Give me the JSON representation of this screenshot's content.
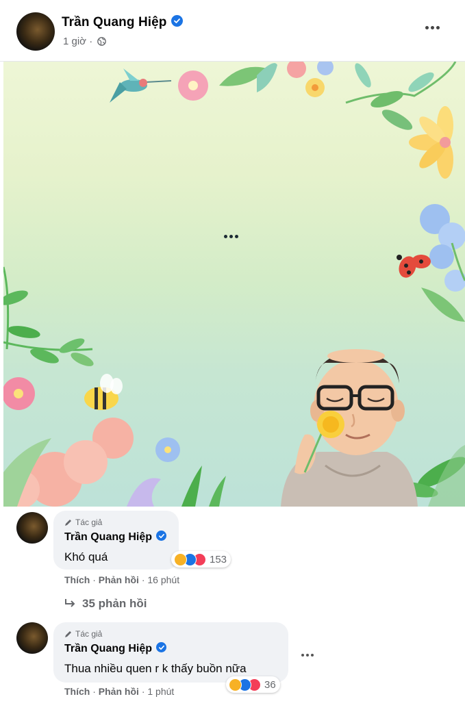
{
  "post": {
    "author": "Trần Quang Hiệp",
    "time": "1 giờ",
    "separator": "·"
  },
  "comments": [
    {
      "author_tag": "Tác giả",
      "author": "Trần Quang Hiệp",
      "text": "Khó quá",
      "reaction_count": "153",
      "like_label": "Thích",
      "reply_label": "Phản hồi",
      "time": "16 phút"
    },
    {
      "author_tag": "Tác giả",
      "author": "Trần Quang Hiệp",
      "text": "Thua nhiều quen r k thấy buồn nữa",
      "reaction_count": "36",
      "like_label": "Thích",
      "reply_label": "Phản hồi",
      "time": "1 phút"
    }
  ],
  "replies_link": "35 phản hồi",
  "icons": {
    "verified": "verified-badge-icon",
    "globe": "globe-icon",
    "more": "more-options-icon",
    "pen": "pencil-icon",
    "reply": "reply-arrow-icon",
    "reactions": [
      "sad-reaction-icon",
      "like-reaction-icon",
      "love-reaction-icon"
    ]
  },
  "colors": {
    "brand_blue": "#1b74e4",
    "meta_gray": "#65676b",
    "bubble_bg": "#f0f2f5"
  }
}
